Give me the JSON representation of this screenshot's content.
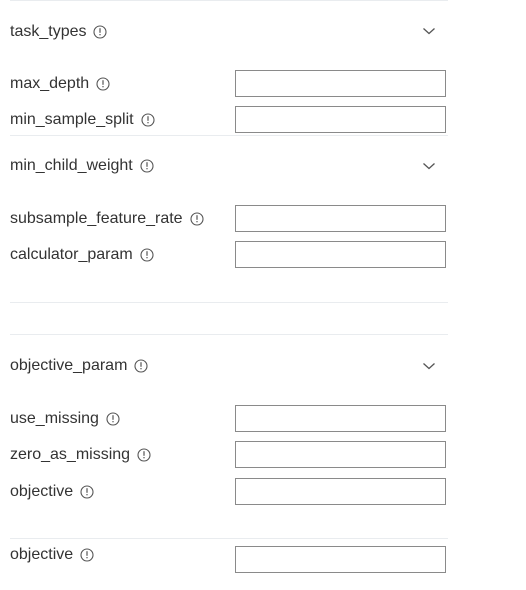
{
  "fields": {
    "task_types": {
      "label": "task_types",
      "value": ""
    },
    "max_depth": {
      "label": "max_depth",
      "value": ""
    },
    "min_sample_split": {
      "label": "min_sample_split",
      "value": ""
    },
    "min_child_weight": {
      "label": "min_child_weight",
      "value": ""
    },
    "subsample_feature_rate": {
      "label": "subsample_feature_rate",
      "value": ""
    },
    "calculator_param": {
      "label": "calculator_param",
      "value": ""
    },
    "objective_param": {
      "label": "objective_param",
      "value": ""
    },
    "use_missing": {
      "label": "use_missing",
      "value": ""
    },
    "zero_as_missing": {
      "label": "zero_as_missing",
      "value": ""
    },
    "objective_1": {
      "label": "objective",
      "value": ""
    },
    "objective_2": {
      "label": "objective",
      "value": ""
    }
  },
  "icons": {
    "info": "info-circle-icon",
    "expand": "chevron-down-icon"
  },
  "colors": {
    "text": "#333333",
    "input_border": "#8a8a8a",
    "divider": "#e9ecef",
    "icon": "#555555"
  }
}
